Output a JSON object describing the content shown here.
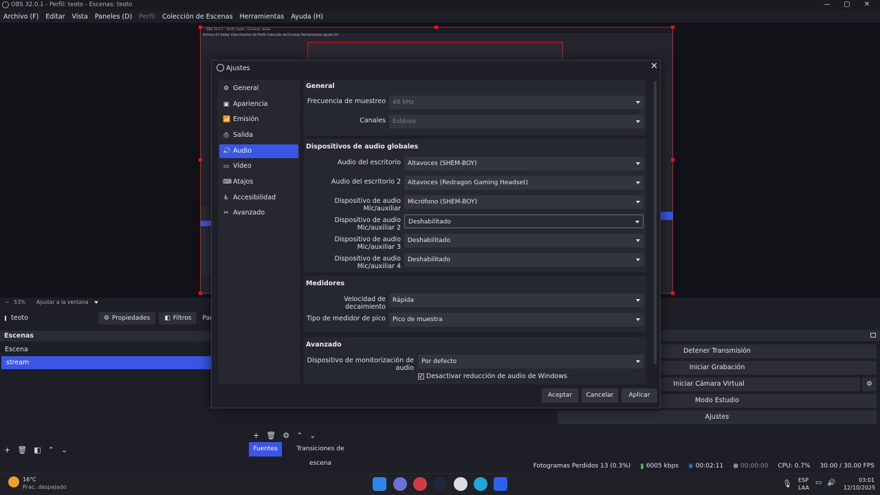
{
  "window": {
    "title": "OBS 32.0.1 - Perfil: teoto - Escenas: teoto",
    "controls": [
      "—",
      "▢",
      "✕"
    ]
  },
  "menu": {
    "items": [
      "Archivo (F)",
      "Editar",
      "Vista",
      "Paneles (D)"
    ],
    "disabled_item": "Perfil",
    "items2": [
      "Colección de Escenas",
      "Herramientas",
      "Ayuda (H)"
    ]
  },
  "preview_mini": {
    "title": "OBS 32.0.1 - Perfil: teoto - Escenas: teoto",
    "menu": "Archivo (F)   Editar   Vista   Paneles (D)   Perfil   Colección de Escenas   Herramientas   Ayuda (H)"
  },
  "zoombar": {
    "minus": "−",
    "zoom": "53%",
    "fit": "Ajustar a la ventana"
  },
  "scene_toolbar": {
    "scene_name": "teoto",
    "properties": "Propiedades",
    "filters": "Filtros",
    "pan": "Pan"
  },
  "scenes": {
    "header": "Escenas",
    "items": [
      "Escena",
      "stream"
    ]
  },
  "controls": {
    "stop_stream": "Detener Transmisión",
    "start_record": "Iniciar Grabación",
    "virtual_cam": "Iniciar Cámara Virtual",
    "studio": "Modo Estudio",
    "settings": "Ajustes"
  },
  "bottom_tabs": {
    "sources": "Fuentes",
    "transitions": "Transiciones de escena"
  },
  "status": {
    "dropped": "Fotogramas Perdidos 13 (0.3%)",
    "bitrate": "6005 kbps",
    "stream_time": "00:02:11",
    "rec_time": "00:00:00",
    "cpu": "CPU: 0.7%",
    "fps": "30.00 / 30.00 FPS"
  },
  "taskbar": {
    "temp": "16°C",
    "weather": "Prac. despejado",
    "lang1": "ESP",
    "lang2": "LAA",
    "time": "03:01",
    "date": "12/10/2025"
  },
  "dialog": {
    "title": "Ajustes",
    "sidebar": [
      "General",
      "Apariencia",
      "Emisión",
      "Salida",
      "Audio",
      "Vídeo",
      "Atajos",
      "Accesibilidad",
      "Avanzado"
    ],
    "active": "Audio",
    "general": {
      "title": "General",
      "sample_rate_label": "Frecuencia de muestreo",
      "sample_rate": "48 kHz",
      "channels_label": "Canales",
      "channels": "Estéreo"
    },
    "global_audio": {
      "title": "Dispositivos de audio globales",
      "desktop1_label": "Audio del escritorio",
      "desktop1": "Altavoces (SHEM-BOY)",
      "desktop2_label": "Audio del escritorio 2",
      "desktop2": "Altavoces (Redragon Gaming Headset)",
      "mic1_label": "Dispositivo de audio Mic/auxiliar",
      "mic1": "Micrófono (SHEM-BOY)",
      "mic2_label": "Dispositivo de audio Mic/auxiliar 2",
      "mic2": "Deshabilitado",
      "mic3_label": "Dispositivo de audio Mic/auxiliar 3",
      "mic3": "Deshabilitado",
      "mic4_label": "Dispositivo de audio Mic/auxiliar 4",
      "mic4": "Deshabilitado"
    },
    "meters": {
      "title": "Medidores",
      "decay_label": "Velocidad de decaimiento",
      "decay": "Rápida",
      "peak_label": "Tipo de medidor de pico",
      "peak": "Pico de muestra"
    },
    "advanced": {
      "title": "Avanzado",
      "monitor_label": "Dispositivo de monitorización de audio",
      "monitor": "Por defecto",
      "ducking": "Desactivar reducción de audio de Windows"
    },
    "buttons": {
      "ok": "Aceptar",
      "cancel": "Cancelar",
      "apply": "Aplicar"
    }
  },
  "colors": {
    "accent": "#3b55e6",
    "selection_red": "#e1141e"
  }
}
